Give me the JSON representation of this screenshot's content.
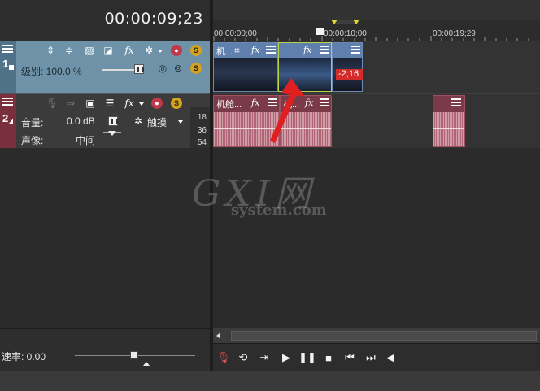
{
  "timeline": {
    "timecode": "00:00:09;23",
    "ruler_labels": [
      "00:00:00;00",
      "00:00:10;00",
      "00:00:19;29"
    ]
  },
  "video_track": {
    "number": "1",
    "level_label": "级别: 100.0 %"
  },
  "audio_track": {
    "number": "2",
    "volume_label": "音量:",
    "volume_value": "0.0 dB",
    "pan_label": "声像:",
    "pan_value": "中间",
    "touch_mode": "触摸",
    "meter_ticks": [
      "18",
      "36",
      "54"
    ]
  },
  "clips": {
    "video_1_title": "机...",
    "video_2_title": "机...",
    "audio_1_title": "机舱...",
    "audio_2_title": "机...",
    "overlap_time": "-2;16"
  },
  "bottom": {
    "rate_label": "速率: 0.00"
  },
  "watermark": {
    "main": "GXI网",
    "sub": "system.com"
  },
  "colors": {
    "video_header": "#6e93a8",
    "audio_strip": "#7a2f3e",
    "video_clip": "#4f6f9a",
    "audio_clip": "#7b3a48",
    "overlap_badge": "#d42b2b",
    "loop_marker": "#e8d82a",
    "arrow": "#e02020"
  }
}
